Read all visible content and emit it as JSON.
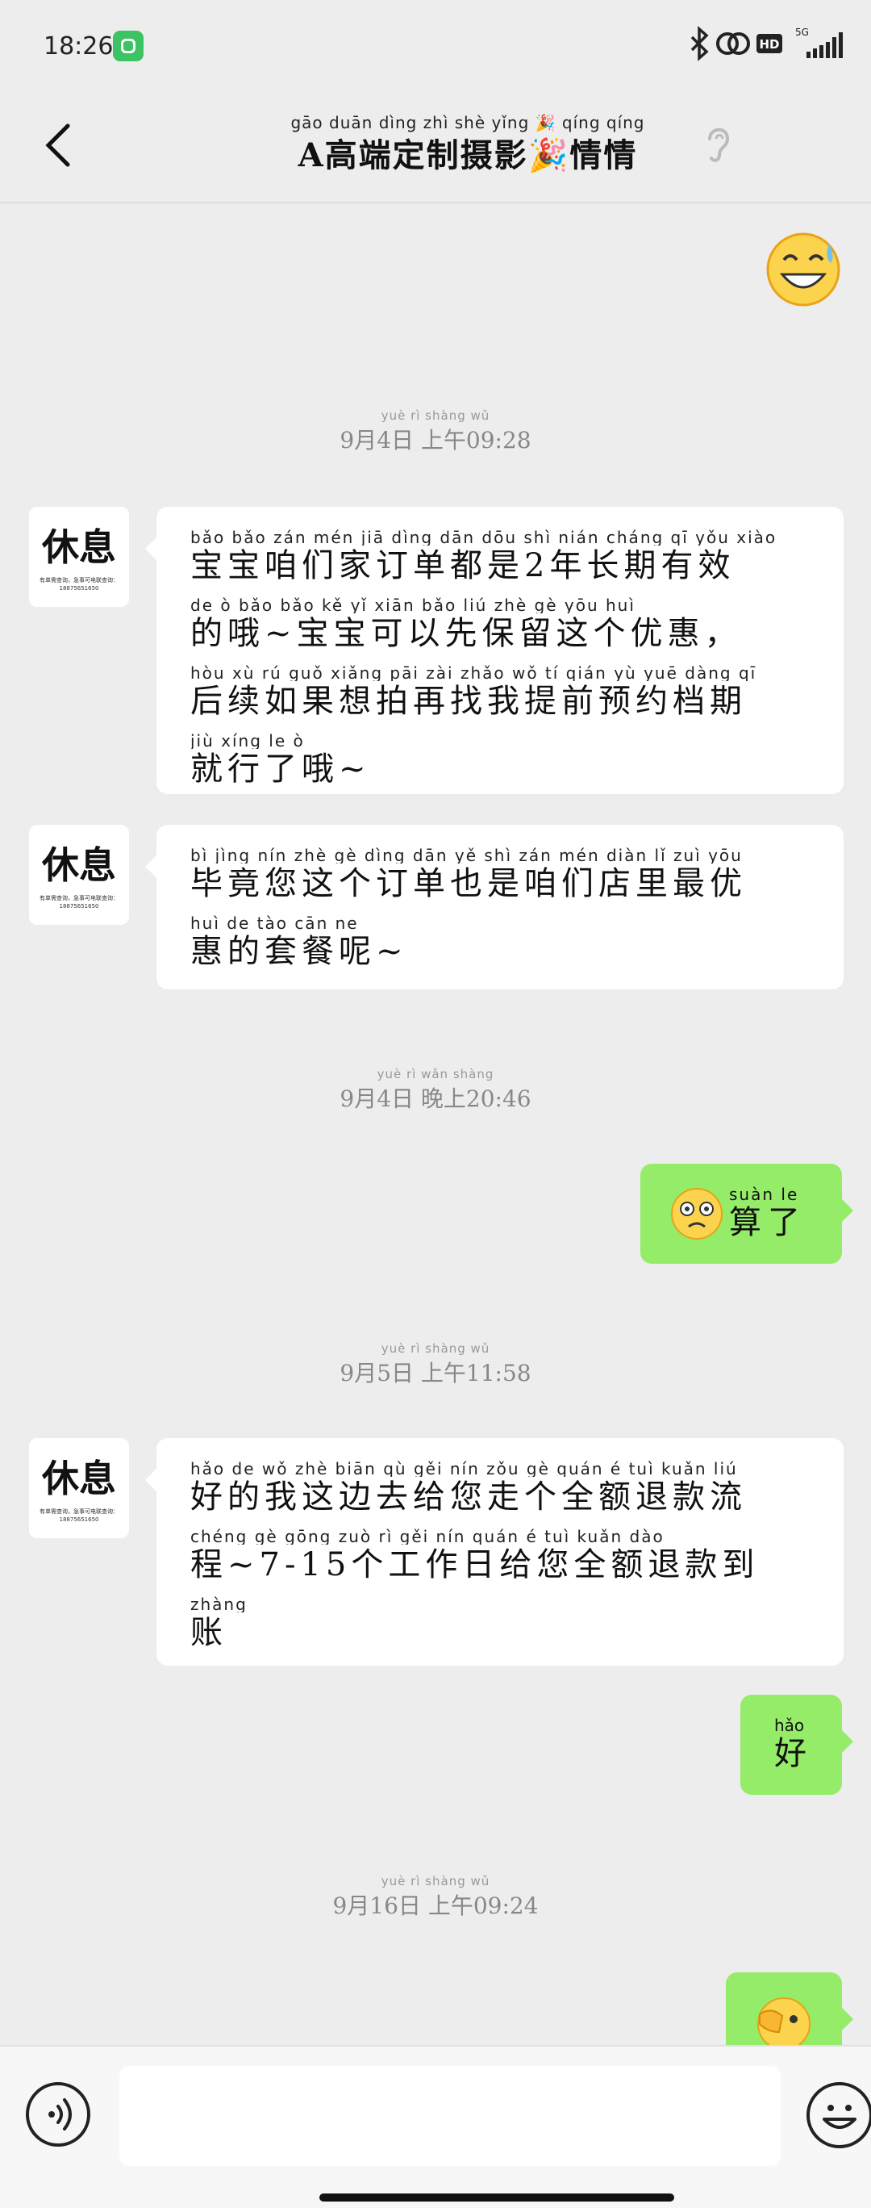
{
  "status_bar": {
    "time": "18:26",
    "network": "5G",
    "hd": "HD"
  },
  "header": {
    "title_pinyin": "gāo duān dìng zhì shè yǐng 🎉 qíng qíng",
    "title": "A高端定制摄影🎉情情"
  },
  "messages": [
    {
      "kind": "timestamp",
      "pinyin": "yuè  rì  shàng wǔ",
      "text": "9月4日 上午09:28"
    },
    {
      "kind": "incoming",
      "avatar_text": "休息",
      "avatar_small": "有单需查询，急事可电联查询：18875651650",
      "lines": [
        {
          "py": "bǎo bǎo  zán mén  jiā  dìng dān dōu shì      nián cháng  qī   yǒu xiào",
          "hz": "宝宝咱们家订单都是2年长期有效"
        },
        {
          "py": "de   ò       bǎo bǎo  kě   yǐ  xiān bǎo  liú  zhè  gè  yōu  huì",
          "hz": "的哦~宝宝可以先保留这个优惠，"
        },
        {
          "py": "hòu  xù  rú  guǒ xiǎng pāi  zài zhǎo  wǒ   tí  qián  yù  yuē dàng  qī",
          "hz": "后续如果想拍再找我提前预约档期"
        },
        {
          "py": "jiù xíng  le    ò",
          "hz": "就行了哦~"
        }
      ]
    },
    {
      "kind": "incoming",
      "avatar_text": "休息",
      "avatar_small": "有单需查询，急事可电联查询：18875651650",
      "lines": [
        {
          "py": "bì  jìng  nín  zhè  gè  dìng  dān   yě   shì   zán  mén diàn  lǐ   zuì  yōu",
          "hz": "毕竟您这个订单也是咱们店里最优"
        },
        {
          "py": "huì   de   tào  cān   ne",
          "hz": "惠的套餐呢~"
        }
      ]
    },
    {
      "kind": "timestamp",
      "pinyin": "yuè  rì  wǎn shàng",
      "text": "9月4日 晚上20:46"
    },
    {
      "kind": "outgoing",
      "py": "suàn  le",
      "hz": "算了"
    },
    {
      "kind": "timestamp",
      "pinyin": "yuè  rì  shàng wǔ",
      "text": "9月5日 上午11:58"
    },
    {
      "kind": "incoming",
      "avatar_text": "休息",
      "avatar_small": "有单需查询，急事可电联查询：18875651650",
      "lines": [
        {
          "py": "hǎo  de    wǒ  zhè biān  qù   gěi  nín  zǒu  gè  quán   é    tuì kuǎn  liú",
          "hz": "好的我这边去给您走个全额退款流"
        },
        {
          "py": "chéng               gè gōng zuò   rì   gěi  nín quán   é    tuì  kuǎn dào",
          "hz": "程~7-15个工作日给您全额退款到"
        },
        {
          "py": "zhàng",
          "hz": "账"
        }
      ]
    },
    {
      "kind": "outgoing",
      "py": "hǎo",
      "hz": "好"
    },
    {
      "kind": "timestamp",
      "pinyin": "yuè   rì  shàng wǔ",
      "text": "9月16日 上午09:24"
    }
  ],
  "input": {
    "value": "",
    "placeholder": ""
  },
  "icons": {
    "back": "back-arrow-icon",
    "ear": "ear-icon",
    "voice": "voice-icon",
    "emoji": "emoji-icon",
    "bluetooth": "bluetooth-icon",
    "link": "link-icon",
    "signal": "signal-icon"
  },
  "colors": {
    "outgoing_bubble": "#95ec69",
    "incoming_bubble": "#ffffff",
    "background": "#ededed"
  }
}
